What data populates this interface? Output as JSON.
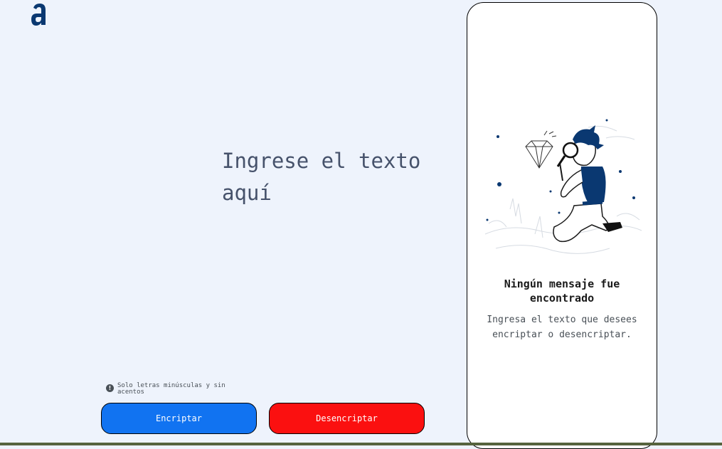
{
  "brand": {
    "logo_icon": "alura-logo-icon",
    "color": "#0a3871"
  },
  "editor": {
    "placeholder": "Ingrese el texto aquí"
  },
  "hint": {
    "icon": "info-icon",
    "text": "Solo letras minúsculas y sin acentos"
  },
  "buttons": {
    "encrypt_label": "Encriptar",
    "decrypt_label": "Desencriptar",
    "encrypt_color": "#1173f1",
    "decrypt_color": "#fb1010"
  },
  "output": {
    "illustration": "person-with-magnifying-glass-illustration",
    "title": "Ningún mensaje fue encontrado",
    "description": "Ingresa el texto que desees encriptar o desencriptar."
  }
}
